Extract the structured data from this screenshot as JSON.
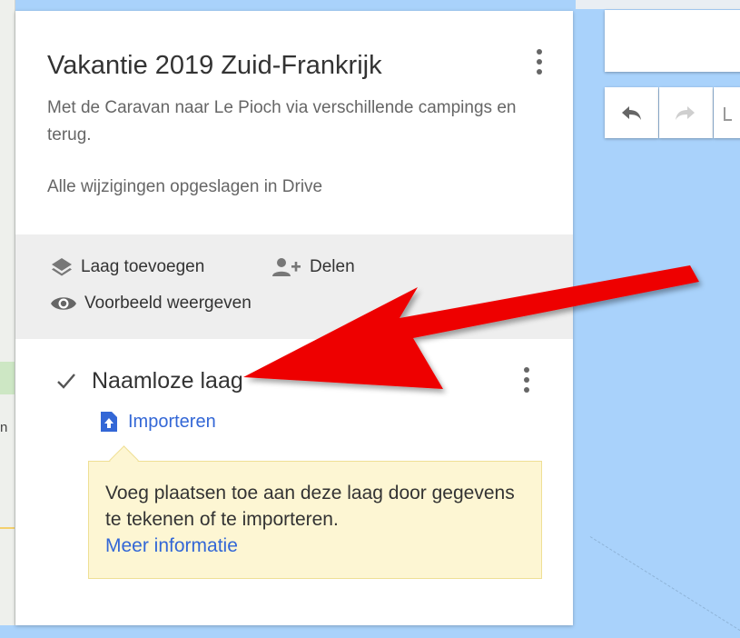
{
  "map": {
    "edge_letter": "n"
  },
  "panel": {
    "title": "Vakantie 2019 Zuid-Frankrijk",
    "description": "Met de Caravan naar Le Pioch via verschillende campings en terug.",
    "saved_status": "Alle wijzigingen opgeslagen in Drive",
    "actions": {
      "add_layer": "Laag toevoegen",
      "share": "Delen",
      "preview": "Voorbeeld weergeven"
    },
    "layer": {
      "name": "Naamloze laag",
      "checked": true,
      "import_label": "Importeren"
    },
    "tooltip": {
      "text": "Voeg plaatsen toe aan deze laag door gegevens te tekenen of te importeren.",
      "link": "Meer informatie"
    }
  },
  "icons": {
    "undo": "undo-icon",
    "redo": "redo-icon",
    "layers": "layers-icon",
    "add_person": "add-person-icon",
    "eye": "eye-icon",
    "upload": "upload-icon"
  },
  "colors": {
    "water": "#a9d2fb",
    "link": "#3367d6",
    "tooltip_bg": "#fdf6d3",
    "annotation_arrow": "#ee0000"
  }
}
